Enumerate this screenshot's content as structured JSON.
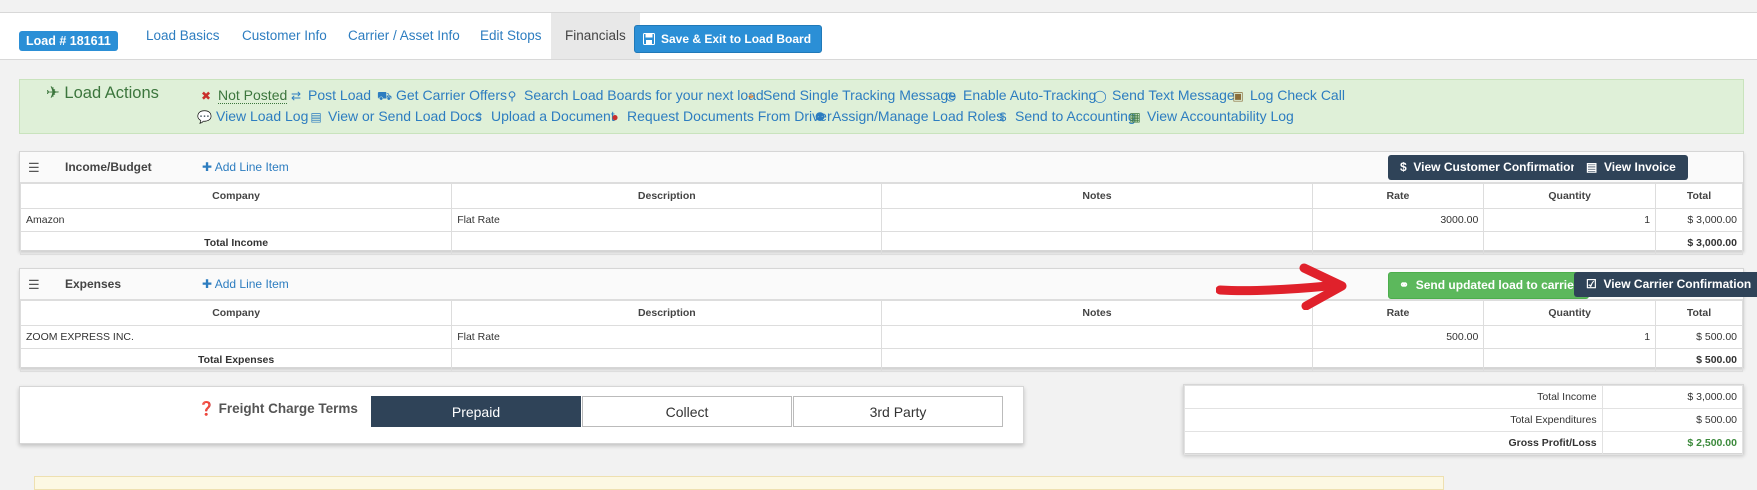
{
  "nav": {
    "load_badge": "Load # 181611",
    "tabs": [
      "Load Basics",
      "Customer Info",
      "Carrier / Asset Info",
      "Edit Stops",
      "Financials"
    ],
    "save_button": "Save & Exit to Load Board"
  },
  "actions": {
    "title": "Load Actions",
    "row1": [
      "Not Posted",
      "Post Load",
      "Get Carrier Offers",
      "Search Load Boards for your next load",
      "Send Single Tracking Message",
      "Enable Auto-Tracking",
      "Send Text Message",
      "Log Check Call"
    ],
    "row2": [
      "View Load Log",
      "View or Send Load Docs",
      "Upload a Document",
      "Request Documents From Driver",
      "Assign/Manage Load Roles",
      "Send to Accounting",
      "View Accountability Log"
    ]
  },
  "income": {
    "title": "Income/Budget",
    "add_line": "Add Line Item",
    "btn_customer_conf": "View Customer Confirmation",
    "btn_invoice": "View Invoice",
    "columns": [
      "Company",
      "Description",
      "Notes",
      "Rate",
      "Quantity",
      "Total"
    ],
    "row": {
      "company": "Amazon",
      "description": "Flat Rate",
      "notes": "",
      "rate": "3000.00",
      "quantity": "1",
      "total": "$ 3,000.00"
    },
    "total_label": "Total Income",
    "total_value": "$ 3,000.00"
  },
  "expenses": {
    "title": "Expenses",
    "add_line": "Add Line Item",
    "btn_send_updated": "Send updated load to carrier",
    "btn_carrier_conf": "View Carrier Confirmation",
    "columns": [
      "Company",
      "Description",
      "Notes",
      "Rate",
      "Quantity",
      "Total"
    ],
    "row": {
      "company": "ZOOM EXPRESS INC.",
      "description": "Flat Rate",
      "notes": "",
      "rate": "500.00",
      "quantity": "1",
      "total": "$ 500.00"
    },
    "total_label": "Total Expenses",
    "total_value": "$ 500.00"
  },
  "terms": {
    "label": "Freight Charge Terms",
    "options": [
      "Prepaid",
      "Collect",
      "3rd Party"
    ],
    "selected": "Prepaid"
  },
  "summary": {
    "rows": [
      {
        "label": "Total Income",
        "value": "$ 3,000.00"
      },
      {
        "label": "Total Expenditures",
        "value": "$ 500.00"
      },
      {
        "label": "Gross Profit/Loss",
        "value": "$ 2,500.00"
      }
    ]
  },
  "colors": {
    "primary": "#2b8fd6",
    "dark": "#2f4358",
    "success": "#5cb85c",
    "alert_bg": "#dff0d8",
    "arrow": "#e0212b"
  }
}
